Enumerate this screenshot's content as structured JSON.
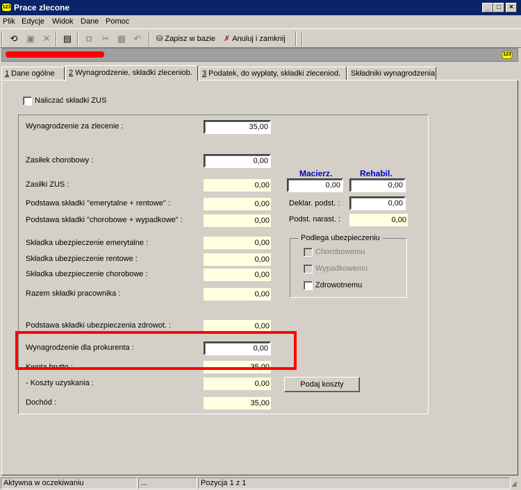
{
  "window": {
    "title": "Prace zlecone",
    "app_icon": "123",
    "buttons": {
      "minimize": "_",
      "maximize": "□",
      "close": "×"
    }
  },
  "menu": [
    "Plik",
    "Edycje",
    "Widok",
    "Dane",
    "Pomoc"
  ],
  "toolbar": {
    "save_label": "Zapisz w bazie",
    "cancel_label": "Anuluj i zamknij"
  },
  "badge": "123",
  "tabs": [
    {
      "key": "1",
      "label": " Dane ogólne"
    },
    {
      "key": "2",
      "label": " Wynagrodzenie, składki zleceniob."
    },
    {
      "key": "3",
      "label": " Podatek, do wypłaty, składki zleceniod."
    },
    {
      "key": "",
      "label": "Składniki wynagrodzenia"
    }
  ],
  "form": {
    "zus_checkbox": "Naliczać składki ZUS",
    "wynagrodzenie_label": "Wynagrodzenie za zlecenie :",
    "wynagrodzenie_value": "35,00",
    "zasilek_label": "Zasiłek chorobowy :",
    "zasilek_value": "0,00",
    "zasilki_zus_label": "Zasiłki ZUS :",
    "zasilki_zus_value": "0,00",
    "podst_emer_label": "Podstawa składki  \"emerytalne + rentowe\" :",
    "podst_emer_value": "0,00",
    "podst_chor_label": "Podstawa składki  \"chorobowe + wypadkowe\" :",
    "podst_chor_value": "0,00",
    "skl_emer_label": "Składka ubezpieczenie emerytalne :",
    "skl_emer_value": "0,00",
    "skl_rent_label": "Składka ubezpieczenie rentowe :",
    "skl_rent_value": "0,00",
    "skl_chor_label": "Składka ubezpieczenie chorobowe :",
    "skl_chor_value": "0,00",
    "razem_label": "Razem składki pracownika :",
    "razem_value": "0,00",
    "podst_zdrow_label": "Podstawa składki ubezpieczenia zdrowot.  :",
    "podst_zdrow_value": "0,00",
    "prokurent_label": "Wynagrodzenie dla prokurenta :",
    "prokurent_value": "0,00",
    "kwota_label": "Kwota brutto :",
    "kwota_value": "35,00",
    "koszty_label": "- Koszty uzyskania :",
    "koszty_value": "0,00",
    "dochod_label": "Dochód :",
    "dochod_value": "35,00",
    "macierz_header": "Macierz.",
    "rehabil_header": "Rehabil.",
    "macierz_value": "0,00",
    "rehabil_value": "0,00",
    "deklar_label": "Deklar. podst. :",
    "deklar_value": "0,00",
    "narast_label": "Podst. narast. :",
    "narast_value": "0,00",
    "podlega_title": "Podlega ubezpieczeniu",
    "chorobowemu": "Chorobowemu",
    "wypadkowemu": "Wypadkowemu",
    "zdrowotnemu": "Zdrowotnemu",
    "podaj_koszty_button": "Podaj koszty"
  },
  "status": {
    "state": "Aktywna w oczekiwaniu",
    "dots": "...",
    "position": "Pozycja 1 z 1"
  }
}
